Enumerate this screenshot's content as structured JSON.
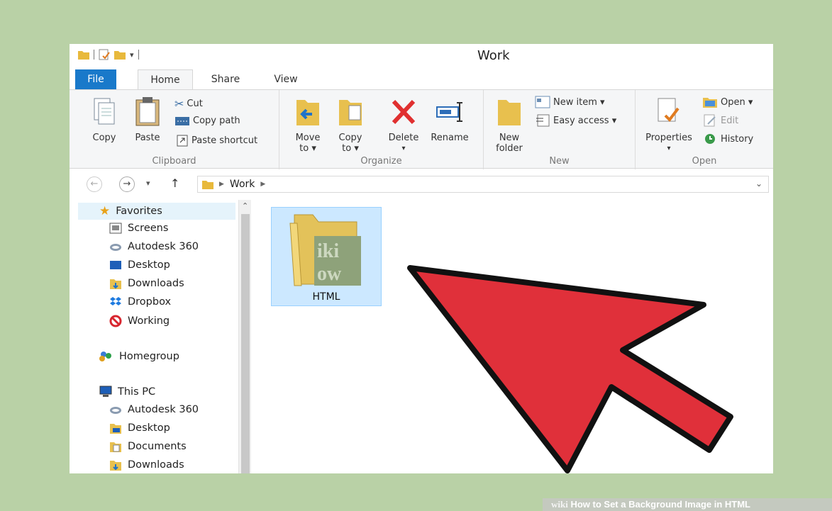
{
  "window": {
    "title": "Work"
  },
  "ribbon_tabs": [
    "File",
    "Home",
    "Share",
    "View"
  ],
  "ribbon": {
    "clipboard": {
      "label": "Clipboard",
      "copy": "Copy",
      "paste": "Paste",
      "cut": "Cut",
      "copy_path": "Copy path",
      "paste_shortcut": "Paste shortcut"
    },
    "organize": {
      "label": "Organize",
      "move_to": [
        "Move",
        "to ▾"
      ],
      "copy_to": [
        "Copy",
        "to ▾"
      ],
      "delete": "Delete",
      "rename": "Rename"
    },
    "new": {
      "label": "New",
      "new_folder": [
        "New",
        "folder"
      ],
      "new_item": "New item ▾",
      "easy_access": "Easy access ▾"
    },
    "open": {
      "label": "Open",
      "properties": "Properties",
      "open": "Open ▾",
      "edit": "Edit",
      "history": "History"
    }
  },
  "address": {
    "back": "←",
    "forward": "→",
    "up": "↑",
    "path": [
      "Work"
    ]
  },
  "nav_pane": {
    "favorites": {
      "label": "Favorites",
      "items": [
        "Screens",
        "Autodesk 360",
        "Desktop",
        "Downloads",
        "Dropbox",
        "Working"
      ]
    },
    "homegroup": "Homegroup",
    "this_pc": {
      "label": "This PC",
      "items": [
        "Autodesk 360",
        "Desktop",
        "Documents",
        "Downloads"
      ]
    }
  },
  "content": {
    "items": [
      {
        "name": "HTML",
        "thumbnail_text": [
          "iki",
          "ow"
        ]
      }
    ]
  },
  "watermark": {
    "brand": "wiki",
    "text": "How to Set a Background Image in HTML"
  },
  "colors": {
    "file_tab": "#1979ca",
    "selection": "#cce8ff",
    "arrow": "#e0303a",
    "background": "#b9d1a6"
  }
}
